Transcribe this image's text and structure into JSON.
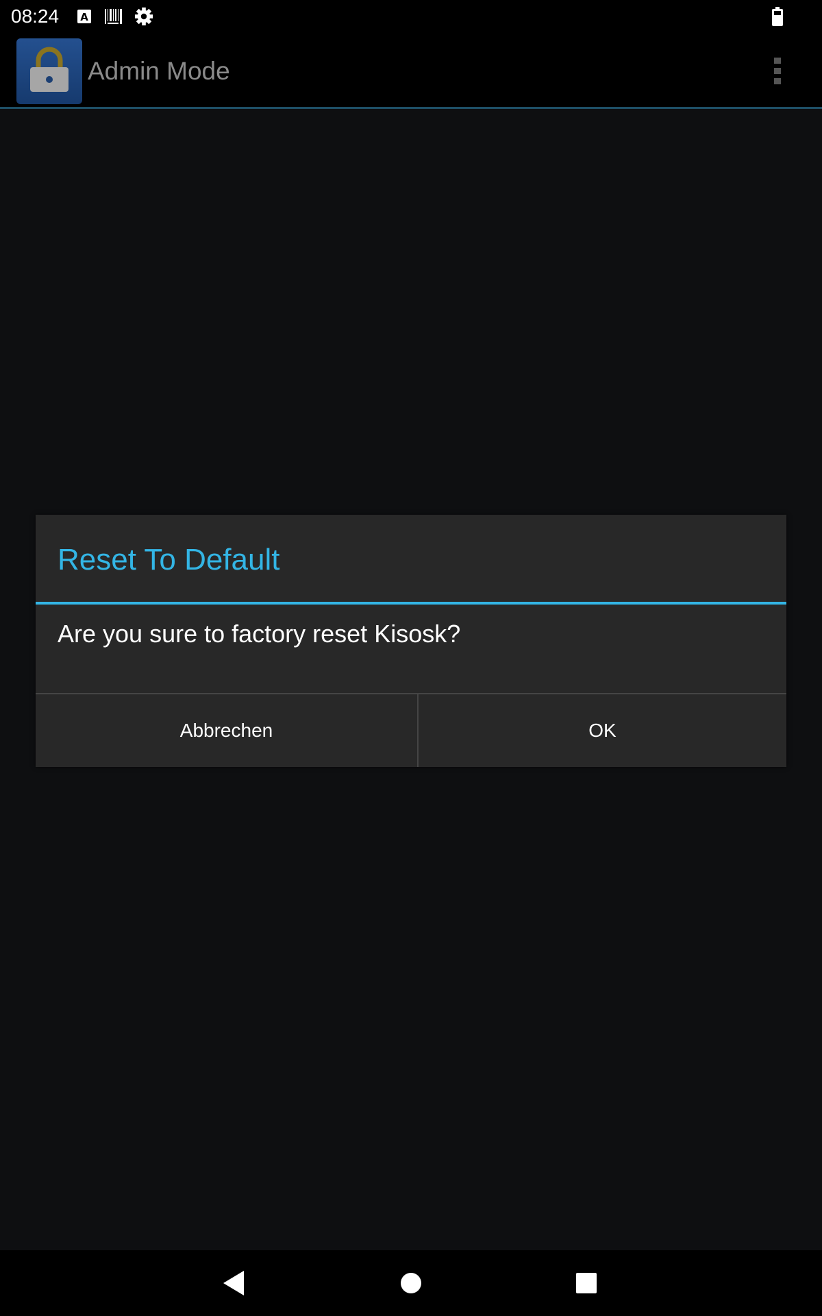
{
  "status_bar": {
    "time": "08:24",
    "icons": [
      "keyboard-a-icon",
      "barcode-icon",
      "settings-gear-icon",
      "battery-icon"
    ]
  },
  "app_bar": {
    "title": "Admin Mode",
    "app_icon": "padlock-icon",
    "menu_icon": "overflow-menu-icon",
    "divider_color": "#1e4f66"
  },
  "dialog": {
    "title": "Reset To Default",
    "message": "Are you sure to factory reset Kisosk?",
    "cancel_label": "Abbrechen",
    "ok_label": "OK",
    "accent_color": "#33b5e5"
  },
  "nav_bar": {
    "icons": [
      "back-icon",
      "home-icon",
      "recents-icon"
    ]
  },
  "colors": {
    "background": "#0e0f11",
    "dialog_background": "#282828",
    "title_text": "#8a8a8a"
  }
}
